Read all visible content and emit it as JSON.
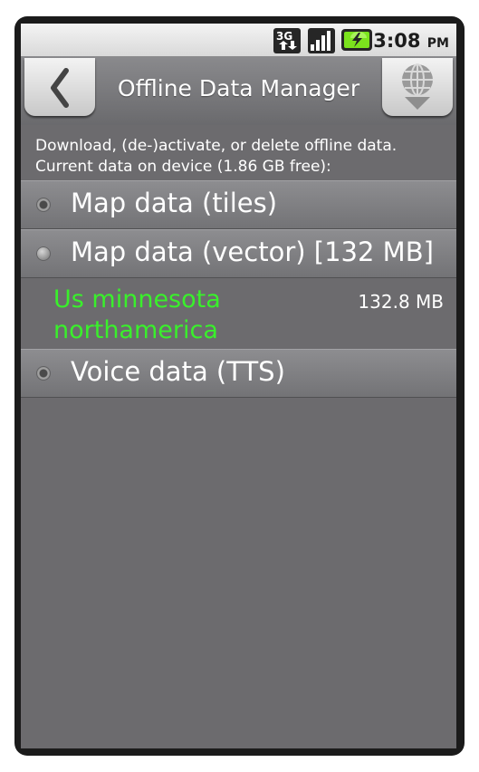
{
  "status_bar": {
    "network_icon": "3g-data-icon",
    "signal_icon": "signal-strength-icon",
    "battery_icon": "battery-charging-icon",
    "time": "3:08",
    "ampm": "PM"
  },
  "title_bar": {
    "back_icon": "chevron-left-icon",
    "title": "Offline Data Manager",
    "download_icon": "globe-download-icon"
  },
  "description": {
    "line1": "Download, (de-)activate, or delete offline data.",
    "line2": "Current data on device (1.86 GB free):"
  },
  "sections": [
    {
      "label": "Map data (tiles)"
    },
    {
      "label": "Map data (vector) [132 MB]"
    },
    {
      "label": "Voice data (TTS)"
    }
  ],
  "vector_entry": {
    "name_line1": "Us minnesota",
    "name_line2": "northamerica",
    "size": "132.8 MB"
  },
  "colors": {
    "background": "#6c6b6e",
    "entry_name": "#39f02b",
    "text": "#ffffff"
  }
}
